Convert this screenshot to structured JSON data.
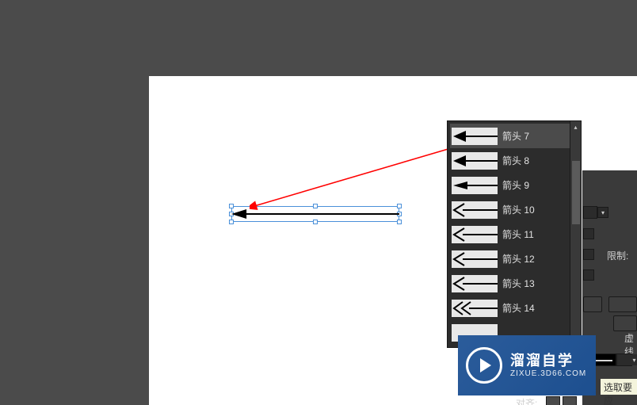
{
  "dropdown": {
    "selected_index": 0,
    "items": [
      {
        "label": "箭头 7",
        "kind": "solid-left"
      },
      {
        "label": "箭头 8",
        "kind": "solid-left"
      },
      {
        "label": "箭头 9",
        "kind": "solid-left-thin"
      },
      {
        "label": "箭头 10",
        "kind": "line-left"
      },
      {
        "label": "箭头 11",
        "kind": "line-left"
      },
      {
        "label": "箭头 12",
        "kind": "line-left"
      },
      {
        "label": "箭头 13",
        "kind": "line-left"
      },
      {
        "label": "箭头 14",
        "kind": "double-left"
      },
      {
        "label": "",
        "kind": "blank"
      }
    ]
  },
  "panel": {
    "limit_label": "限制:",
    "dash_label": "虚线",
    "hint_text": "选取要应",
    "align_label": "对齐:"
  },
  "artwork": {
    "applied_arrow": "箭头 7"
  },
  "watermark": {
    "title": "溜溜自学",
    "subtitle": "ZIXUE.3D66.COM"
  }
}
